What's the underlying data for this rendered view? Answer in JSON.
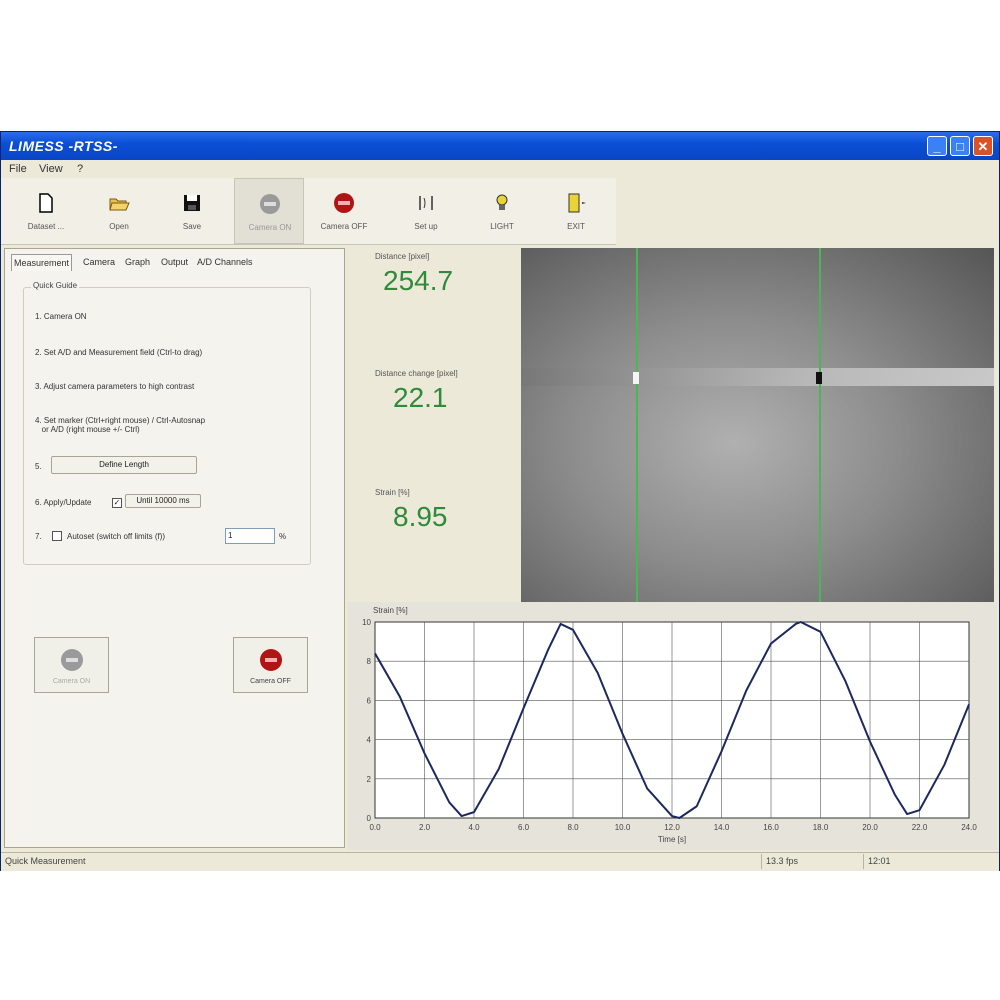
{
  "window": {
    "title": "LIMESS -RTSS-"
  },
  "menu": [
    "File",
    "View",
    "?"
  ],
  "toolbar": {
    "items": [
      {
        "name": "new",
        "label": "Dataset ..."
      },
      {
        "name": "open",
        "label": "Open"
      },
      {
        "name": "save",
        "label": "Save"
      },
      {
        "name": "camera-on",
        "label": "Camera ON"
      },
      {
        "name": "camera-off",
        "label": "Camera OFF"
      },
      {
        "name": "setup",
        "label": "Set up"
      },
      {
        "name": "light",
        "label": "LIGHT"
      },
      {
        "name": "exit",
        "label": "EXIT"
      }
    ]
  },
  "tabs": [
    "Measurement",
    "Camera",
    "Graph",
    "Output",
    "A/D Channels"
  ],
  "quick_guide": {
    "title": "Quick Guide",
    "steps": [
      "1. Camera ON",
      "2. Set A/D and Measurement field (Ctrl-to drag)",
      "3. Adjust camera parameters to high contrast",
      "4. Set marker (Ctrl+right mouse) / Ctrl-Autosnap\n   or A/D (right mouse +/- Ctrl)",
      "5.",
      "6. Apply/Update",
      "7."
    ],
    "define_length_button": "Define Length",
    "apply_checkbox_label": "Until 10000 ms",
    "auto_checkbox_label": "Autoset (switch off limits (f))",
    "auto_value": "1",
    "auto_unit": "%"
  },
  "big_buttons": {
    "camera_on": "Camera ON",
    "camera_off": "Camera OFF"
  },
  "readouts": [
    {
      "label": "Distance [pixel]",
      "value": "254.7"
    },
    {
      "label": "Distance change [pixel]",
      "value": "22.1"
    },
    {
      "label": "Strain [%]",
      "value": "8.95"
    }
  ],
  "chart_data": {
    "type": "line",
    "title": "Strain [%]",
    "xlabel": "Time [s]",
    "ylabel": "",
    "x_ticks": [
      "0.0",
      "2.0",
      "4.0",
      "6.0",
      "8.0",
      "10.0",
      "12.0",
      "14.0",
      "16.0",
      "18.0",
      "20.0",
      "22.0",
      "24.0"
    ],
    "y_ticks": [
      "0",
      "2",
      "4",
      "6",
      "8",
      "10"
    ],
    "xlim": [
      0,
      24
    ],
    "ylim": [
      0,
      10
    ],
    "series": [
      {
        "color": "#1e2860",
        "x": [
          0,
          1,
          2,
          3,
          3.5,
          4,
          5,
          6,
          7,
          7.5,
          8,
          9,
          10,
          11,
          12,
          12.3,
          13,
          14,
          15,
          16,
          17,
          17.2,
          18,
          19,
          20,
          21,
          21.5,
          22,
          23,
          24
        ],
        "y": [
          8.4,
          6.2,
          3.3,
          0.8,
          0.1,
          0.3,
          2.5,
          5.6,
          8.6,
          9.9,
          9.6,
          7.4,
          4.3,
          1.5,
          0.1,
          0.0,
          0.6,
          3.4,
          6.5,
          8.9,
          9.9,
          10.0,
          9.5,
          7.0,
          3.9,
          1.2,
          0.2,
          0.4,
          2.7,
          5.8
        ]
      }
    ],
    "grid": true
  },
  "status": {
    "left": "Quick Measurement",
    "mid": "13.3 fps",
    "right": "12:01"
  }
}
